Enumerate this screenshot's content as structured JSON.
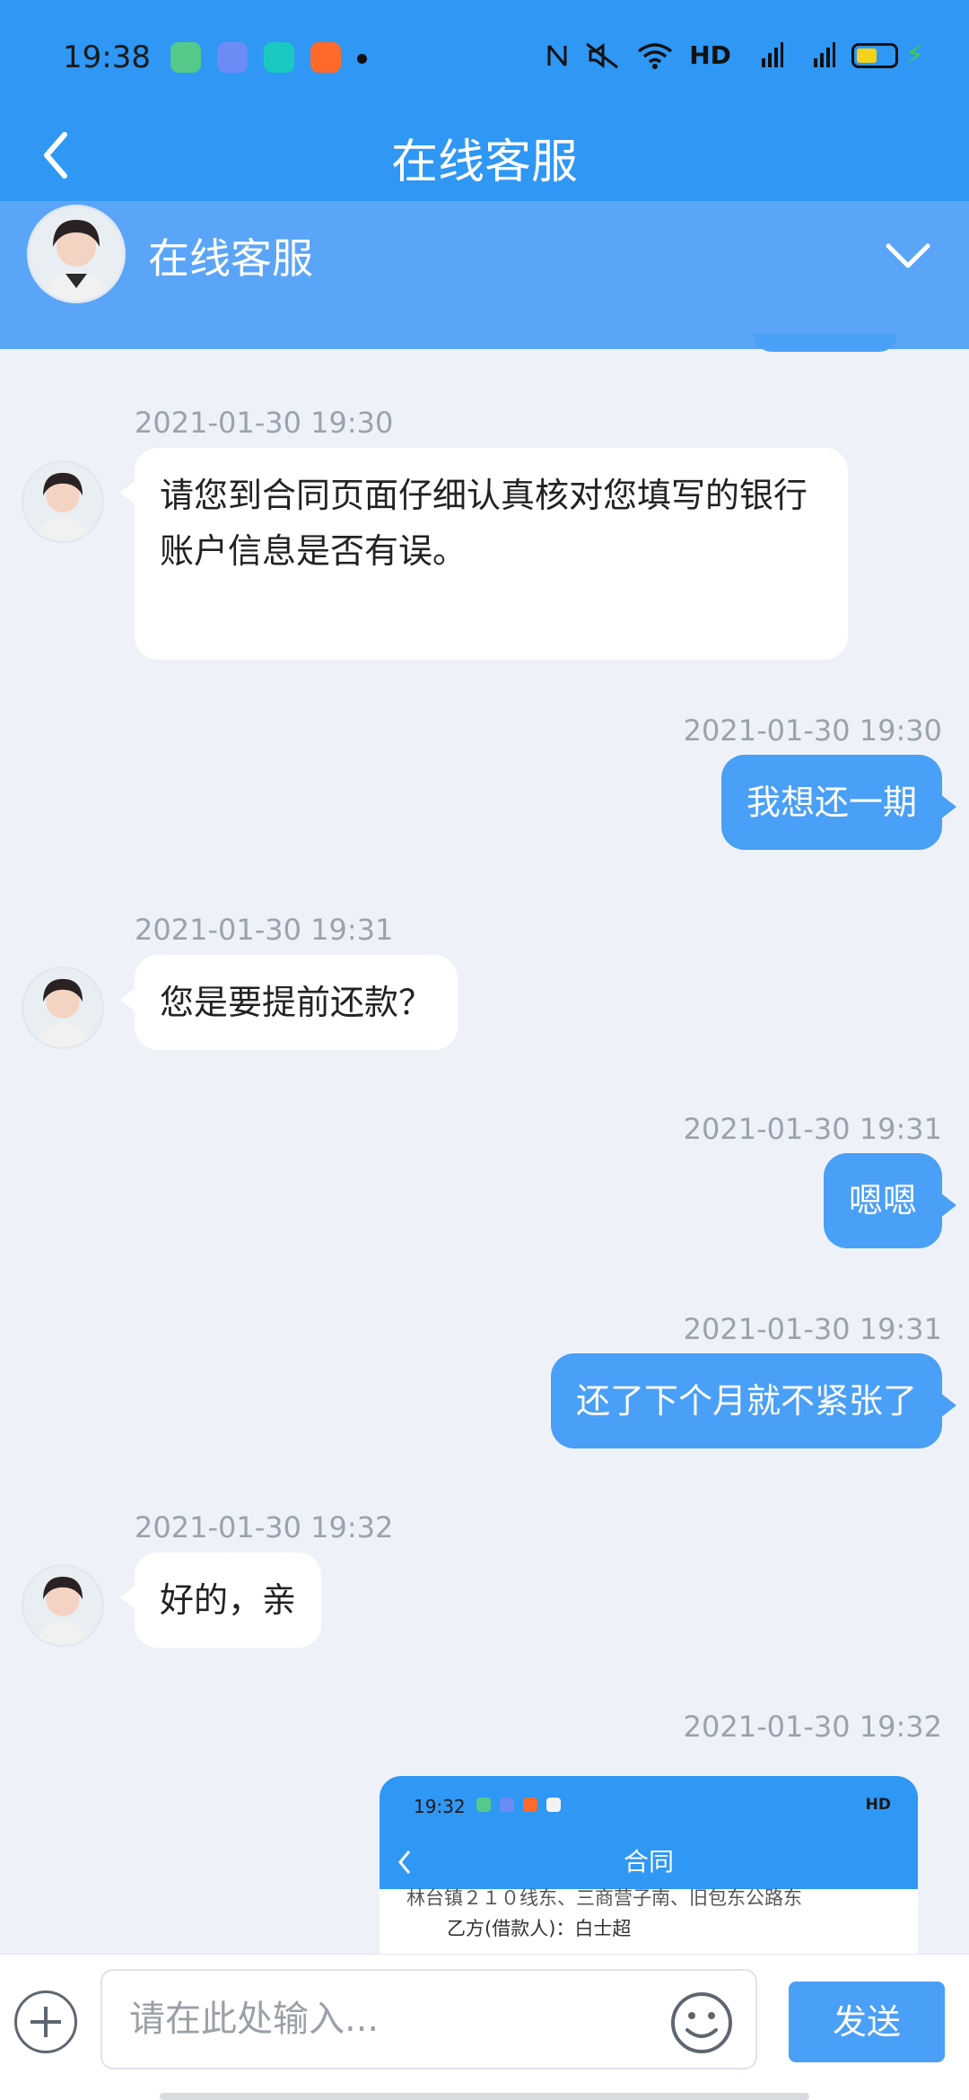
{
  "status_bar": {
    "time": "19:38",
    "right_text": "HD",
    "app_icons": [
      {
        "name": "notes-app-icon",
        "color": "#55c98a"
      },
      {
        "name": "infinity-app-icon",
        "color": "#6c8cf5"
      },
      {
        "name": "camera-app-icon",
        "color": "#19c9c1"
      },
      {
        "name": "kuaishou-app-icon",
        "color": "#ff6a2b"
      }
    ],
    "battery_color": "#f3d21a"
  },
  "header": {
    "title": "在线客服",
    "agent_name": "在线客服"
  },
  "messages": [
    {
      "side": "in",
      "timestamp": "2021-01-30 19:30",
      "text": "请您到合同页面仔细认真核对您填写的银行账户信息是否有误。"
    },
    {
      "side": "out",
      "timestamp": "2021-01-30 19:30",
      "text": "我想还一期"
    },
    {
      "side": "in",
      "timestamp": "2021-01-30 19:31",
      "text": "您是要提前还款？"
    },
    {
      "side": "out",
      "timestamp": "2021-01-30 19:31",
      "text": "嗯嗯"
    },
    {
      "side": "out",
      "timestamp": "2021-01-30 19:31",
      "text": "还了下个月就不紧张了"
    },
    {
      "side": "in",
      "timestamp": "2021-01-30 19:32",
      "text": "好的，亲"
    },
    {
      "side": "out",
      "timestamp": "2021-01-30 19:32",
      "type": "image"
    }
  ],
  "image_message": {
    "status_time": "19:32",
    "status_right": "HD",
    "title": "合同",
    "line1": "林台镇２１０线东、三商营子南、旧包东公路东",
    "line2": "乙方(借款人)：白士超"
  },
  "input": {
    "placeholder": "请在此处输入...",
    "value": "",
    "send_label": "发送"
  },
  "colors": {
    "accent": "#2f97f4",
    "bubble_out": "#4a9ff6",
    "bubble_in": "#ffffff",
    "background": "#eef2f8"
  }
}
